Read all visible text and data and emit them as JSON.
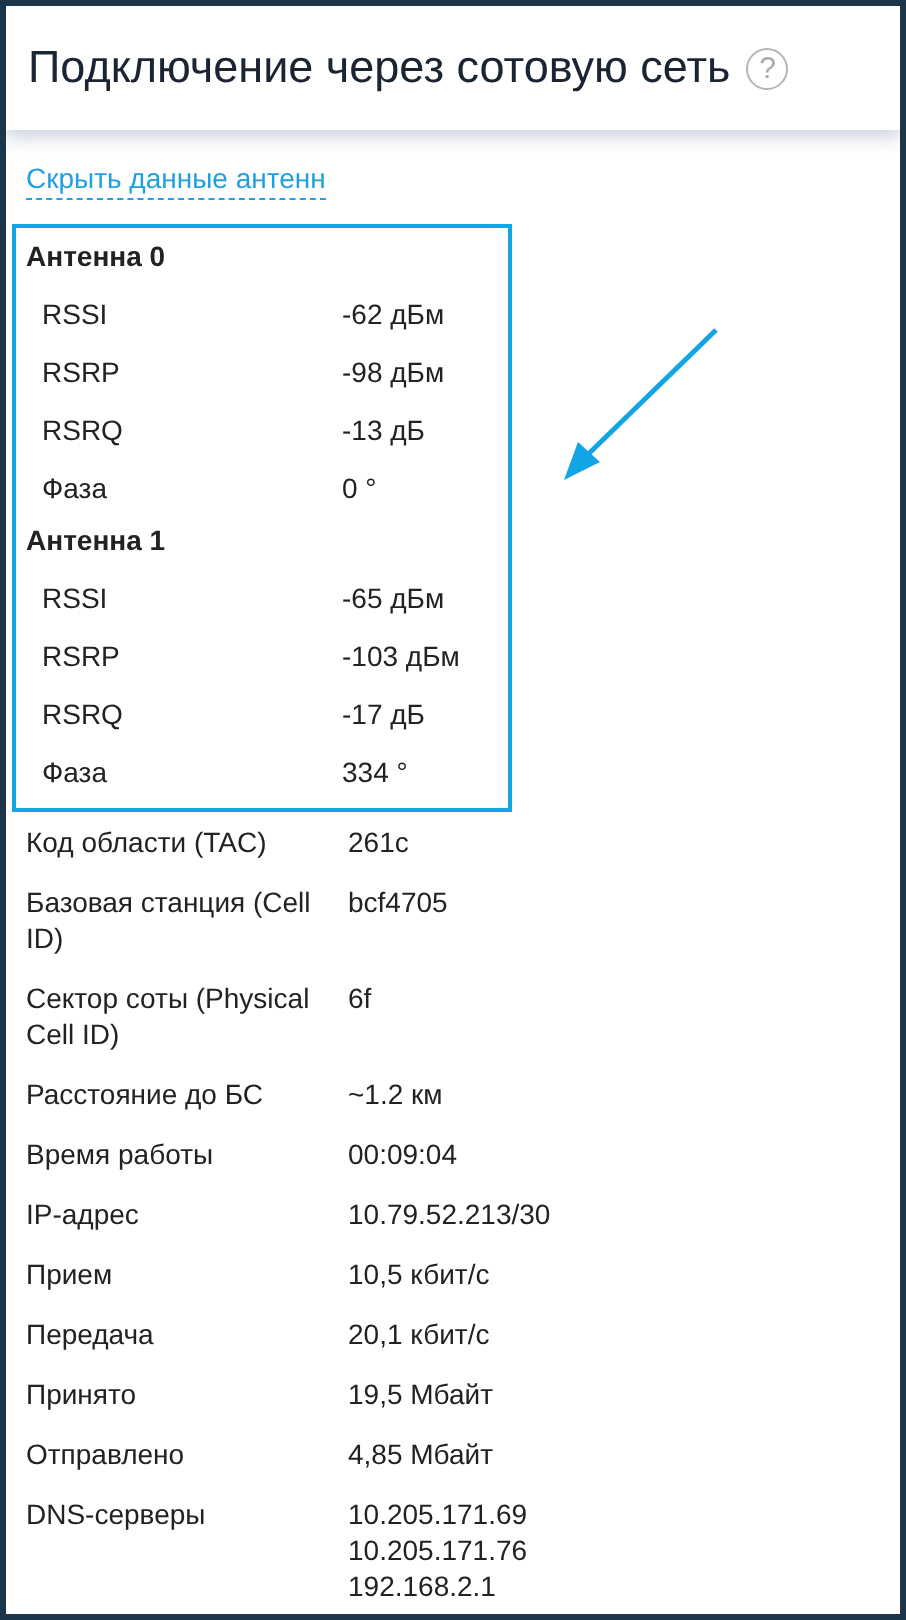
{
  "header": {
    "title": "Подключение через сотовую сеть",
    "help": "?"
  },
  "toggle_link": "Скрыть данные антенн",
  "antennas": [
    {
      "title": "Антенна 0",
      "rows": [
        {
          "label": "RSSI",
          "value": "-62 дБм"
        },
        {
          "label": "RSRP",
          "value": "-98 дБм"
        },
        {
          "label": "RSRQ",
          "value": "-13 дБ"
        },
        {
          "label": "Фаза",
          "value": "0 °"
        }
      ]
    },
    {
      "title": "Антенна 1",
      "rows": [
        {
          "label": "RSSI",
          "value": "-65 дБм"
        },
        {
          "label": "RSRP",
          "value": "-103 дБм"
        },
        {
          "label": "RSRQ",
          "value": "-17 дБ"
        },
        {
          "label": "Фаза",
          "value": "334 °"
        }
      ]
    }
  ],
  "info": [
    {
      "label": "Код области (TAC)",
      "values": [
        "261c"
      ]
    },
    {
      "label": "Базовая станция (Cell ID)",
      "values": [
        "bcf4705"
      ]
    },
    {
      "label": "Сектор соты (Physical Cell ID)",
      "values": [
        "6f"
      ]
    },
    {
      "label": "Расстояние до БС",
      "values": [
        "~1.2 км"
      ]
    },
    {
      "label": "Время работы",
      "values": [
        "00:09:04"
      ]
    },
    {
      "label": "IP-адрес",
      "values": [
        "10.79.52.213/30"
      ]
    },
    {
      "label": "Прием",
      "values": [
        "10,5 кбит/с"
      ]
    },
    {
      "label": "Передача",
      "values": [
        "20,1 кбит/с"
      ]
    },
    {
      "label": "Принято",
      "values": [
        "19,5 Мбайт"
      ]
    },
    {
      "label": "Отправлено",
      "values": [
        "4,85 Мбайт"
      ]
    },
    {
      "label": "DNS-серверы",
      "values": [
        "10.205.171.69",
        "10.205.171.76",
        "192.168.2.1"
      ]
    }
  ]
}
